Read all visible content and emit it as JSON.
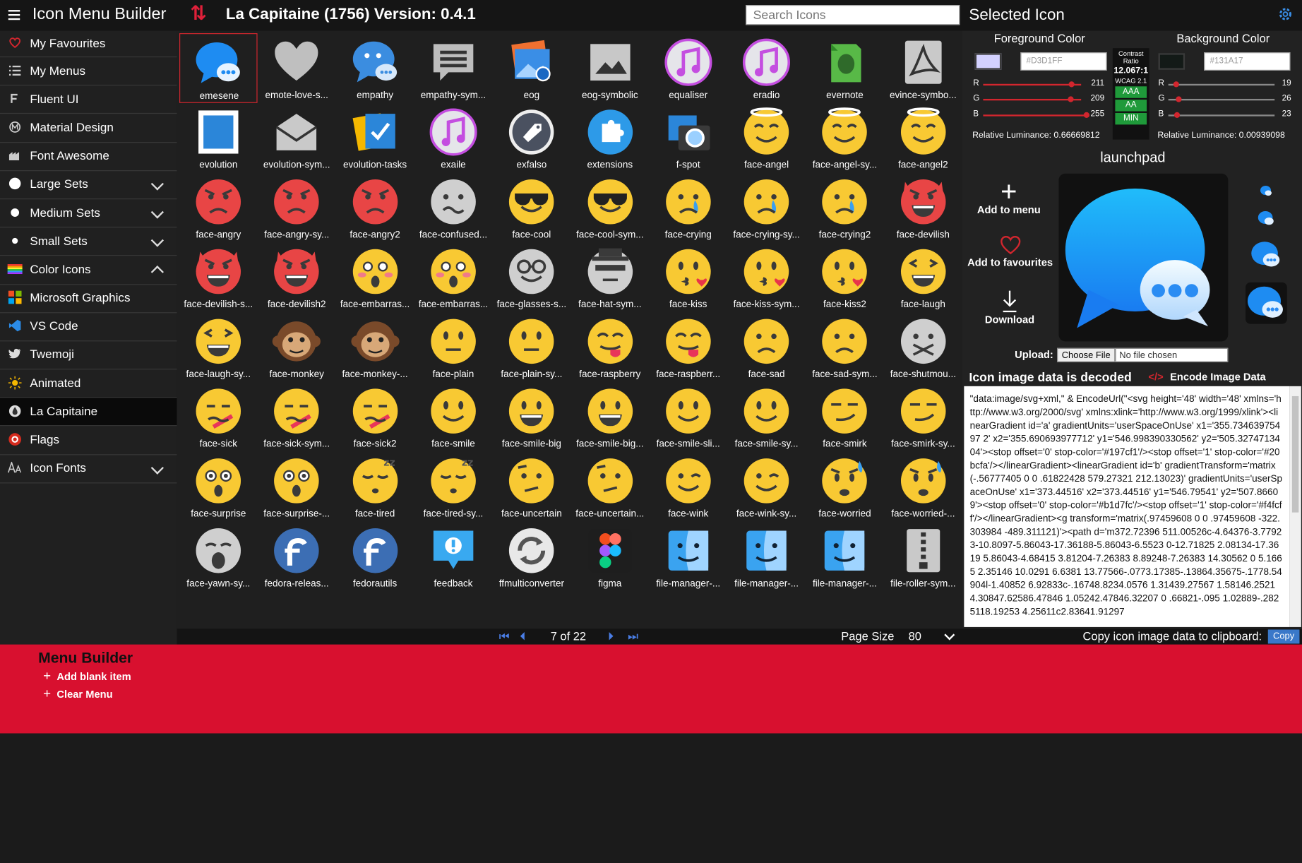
{
  "app": {
    "title": "Icon Menu Builder",
    "page_title": "La Capitaine (1756) Version: 0.4.1",
    "search_placeholder": "Search Icons"
  },
  "sidebar": {
    "items": [
      {
        "label": "My Favourites",
        "icon": "heart-icon",
        "expand": "none",
        "active": false
      },
      {
        "label": "My Menus",
        "icon": "list-icon",
        "expand": "none",
        "active": false
      },
      {
        "label": "Fluent UI",
        "icon": "fluent-icon",
        "expand": "none",
        "active": false
      },
      {
        "label": "Material Design",
        "icon": "material-icon",
        "expand": "none",
        "active": false
      },
      {
        "label": "Font Awesome",
        "icon": "font-awesome-icon",
        "expand": "none",
        "active": false
      },
      {
        "label": "Large Sets",
        "icon": "large-dot-icon",
        "expand": "down",
        "active": false
      },
      {
        "label": "Medium Sets",
        "icon": "medium-dot-icon",
        "expand": "down",
        "active": false
      },
      {
        "label": "Small Sets",
        "icon": "small-dot-icon",
        "expand": "down",
        "active": false
      },
      {
        "label": "Color Icons",
        "icon": "rainbow-icon",
        "expand": "up",
        "active": false
      },
      {
        "label": "Microsoft Graphics",
        "icon": "microsoft-icon",
        "expand": "none",
        "active": false
      },
      {
        "label": "VS Code",
        "icon": "vscode-icon",
        "expand": "none",
        "active": false
      },
      {
        "label": "Twemoji",
        "icon": "twitter-icon",
        "expand": "none",
        "active": false
      },
      {
        "label": "Animated",
        "icon": "sun-icon",
        "expand": "none",
        "active": false
      },
      {
        "label": "La Capitaine",
        "icon": "drop-icon",
        "expand": "none",
        "active": true
      },
      {
        "label": "Flags",
        "icon": "flag-icon",
        "expand": "none",
        "active": false
      },
      {
        "label": "Icon Fonts",
        "icon": "font-icon",
        "expand": "down",
        "active": false
      }
    ]
  },
  "grid": {
    "selected_index": 0,
    "icons": [
      {
        "label": "emesene",
        "icon": "chat-bubbles-icon"
      },
      {
        "label": "emote-love-s...",
        "icon": "heart-icon"
      },
      {
        "label": "empathy",
        "icon": "chat-face-icon"
      },
      {
        "label": "empathy-sym...",
        "icon": "chat-lines-icon"
      },
      {
        "label": "eog",
        "icon": "photo-stack-icon"
      },
      {
        "label": "eog-symbolic",
        "icon": "image-icon"
      },
      {
        "label": "equaliser",
        "icon": "music-note-icon"
      },
      {
        "label": "eradio",
        "icon": "music-note-icon"
      },
      {
        "label": "evernote",
        "icon": "evernote-icon"
      },
      {
        "label": "evince-symbo...",
        "icon": "pdf-icon"
      },
      {
        "label": "evolution",
        "icon": "stamp-icon"
      },
      {
        "label": "evolution-sym...",
        "icon": "envelope-icon"
      },
      {
        "label": "evolution-tasks",
        "icon": "check-card-icon"
      },
      {
        "label": "exaile",
        "icon": "music-note-icon"
      },
      {
        "label": "exfalso",
        "icon": "tag-icon"
      },
      {
        "label": "extensions",
        "icon": "puzzle-icon"
      },
      {
        "label": "f-spot",
        "icon": "camera-icon"
      },
      {
        "label": "face-angel",
        "icon": "face-angel-icon"
      },
      {
        "label": "face-angel-sy...",
        "icon": "face-angel-icon"
      },
      {
        "label": "face-angel2",
        "icon": "face-angel-icon"
      },
      {
        "label": "face-angry",
        "icon": "face-angry-icon"
      },
      {
        "label": "face-angry-sy...",
        "icon": "face-angry-icon"
      },
      {
        "label": "face-angry2",
        "icon": "face-angry-icon"
      },
      {
        "label": "face-confused...",
        "icon": "face-confused-icon"
      },
      {
        "label": "face-cool",
        "icon": "face-cool-icon"
      },
      {
        "label": "face-cool-sym...",
        "icon": "face-cool-icon"
      },
      {
        "label": "face-crying",
        "icon": "face-crying-icon"
      },
      {
        "label": "face-crying-sy...",
        "icon": "face-crying-icon"
      },
      {
        "label": "face-crying2",
        "icon": "face-crying-icon"
      },
      {
        "label": "face-devilish",
        "icon": "face-devil-icon"
      },
      {
        "label": "face-devilish-s...",
        "icon": "face-devil-icon"
      },
      {
        "label": "face-devilish2",
        "icon": "face-devil-icon"
      },
      {
        "label": "face-embarras...",
        "icon": "face-embarrassed-icon"
      },
      {
        "label": "face-embarras...",
        "icon": "face-embarrassed-icon"
      },
      {
        "label": "face-glasses-s...",
        "icon": "face-glasses-icon"
      },
      {
        "label": "face-hat-sym...",
        "icon": "face-hat-icon"
      },
      {
        "label": "face-kiss",
        "icon": "face-kiss-icon"
      },
      {
        "label": "face-kiss-sym...",
        "icon": "face-kiss-icon"
      },
      {
        "label": "face-kiss2",
        "icon": "face-kiss-icon"
      },
      {
        "label": "face-laugh",
        "icon": "face-laugh-icon"
      },
      {
        "label": "face-laugh-sy...",
        "icon": "face-laugh-icon"
      },
      {
        "label": "face-monkey",
        "icon": "face-monkey-icon"
      },
      {
        "label": "face-monkey-...",
        "icon": "face-monkey-icon"
      },
      {
        "label": "face-plain",
        "icon": "face-plain-icon"
      },
      {
        "label": "face-plain-sy...",
        "icon": "face-plain-icon"
      },
      {
        "label": "face-raspberry",
        "icon": "face-raspberry-icon"
      },
      {
        "label": "face-raspberr...",
        "icon": "face-raspberry-icon"
      },
      {
        "label": "face-sad",
        "icon": "face-sad-icon"
      },
      {
        "label": "face-sad-sym...",
        "icon": "face-sad-icon"
      },
      {
        "label": "face-shutmou...",
        "icon": "face-shutmouth-icon"
      },
      {
        "label": "face-sick",
        "icon": "face-sick-icon"
      },
      {
        "label": "face-sick-sym...",
        "icon": "face-sick-icon"
      },
      {
        "label": "face-sick2",
        "icon": "face-sick-icon"
      },
      {
        "label": "face-smile",
        "icon": "face-smile-icon"
      },
      {
        "label": "face-smile-big",
        "icon": "face-smile-big-icon"
      },
      {
        "label": "face-smile-big...",
        "icon": "face-smile-big-icon"
      },
      {
        "label": "face-smile-sli...",
        "icon": "face-smile-icon"
      },
      {
        "label": "face-smile-sy...",
        "icon": "face-smile-icon"
      },
      {
        "label": "face-smirk",
        "icon": "face-smirk-icon"
      },
      {
        "label": "face-smirk-sy...",
        "icon": "face-smirk-icon"
      },
      {
        "label": "face-surprise",
        "icon": "face-surprise-icon"
      },
      {
        "label": "face-surprise-...",
        "icon": "face-surprise-icon"
      },
      {
        "label": "face-tired",
        "icon": "face-tired-icon"
      },
      {
        "label": "face-tired-sy...",
        "icon": "face-tired-icon"
      },
      {
        "label": "face-uncertain",
        "icon": "face-uncertain-icon"
      },
      {
        "label": "face-uncertain...",
        "icon": "face-uncertain-icon"
      },
      {
        "label": "face-wink",
        "icon": "face-wink-icon"
      },
      {
        "label": "face-wink-sy...",
        "icon": "face-wink-icon"
      },
      {
        "label": "face-worried",
        "icon": "face-worried-icon"
      },
      {
        "label": "face-worried-...",
        "icon": "face-worried-icon"
      },
      {
        "label": "face-yawn-sy...",
        "icon": "face-yawn-icon"
      },
      {
        "label": "fedora-releas...",
        "icon": "fedora-icon"
      },
      {
        "label": "fedorautils",
        "icon": "fedora-icon"
      },
      {
        "label": "feedback",
        "icon": "feedback-icon"
      },
      {
        "label": "ffmulticonverter",
        "icon": "convert-icon"
      },
      {
        "label": "figma",
        "icon": "figma-icon"
      },
      {
        "label": "file-manager-...",
        "icon": "finder-icon"
      },
      {
        "label": "file-manager-...",
        "icon": "finder-icon"
      },
      {
        "label": "file-manager-...",
        "icon": "finder-icon"
      },
      {
        "label": "file-roller-sym...",
        "icon": "zip-icon"
      }
    ]
  },
  "pager": {
    "indicator": "7 of 22",
    "page_size_label": "Page Size",
    "page_size_value": "80"
  },
  "selected": {
    "panel_title": "Selected Icon",
    "foreground_label": "Foreground Color",
    "background_label": "Background Color",
    "fg_hex": "#D3D1FF",
    "bg_hex": "#131A17",
    "fg_rgb": {
      "r": "211",
      "g": "209",
      "b": "255"
    },
    "bg_rgb": {
      "r": "19",
      "g": "26",
      "b": "23"
    },
    "rgb_letters": {
      "r": "R",
      "g": "G",
      "b": "B"
    },
    "fg_luminance": "Relative Luminance: 0.66669812",
    "bg_luminance": "Relative Luminance: 0.00939098",
    "contrast_label": "Contrast Ratio",
    "contrast_value": "12.067:1",
    "wcag_label": "WCAG 2.1",
    "wcag_aaa": "AAA",
    "wcag_aa": "AA",
    "wcag_min": "MIN",
    "icon_name": "launchpad",
    "add_to_menu": "Add to menu",
    "add_to_favourites": "Add to favourites",
    "download": "Download",
    "upload_label": "Upload:",
    "choose_file": "Choose File",
    "no_file": "No file chosen",
    "decoded_title": "Icon image data is decoded",
    "encode_label": "Encode Image Data",
    "image_data": "\"data:image/svg+xml,\" & EncodeUrl(\"<svg height='48' width='48' xmlns='http://www.w3.org/2000/svg' xmlns:xlink='http://www.w3.org/1999/xlink'><linearGradient id='a' gradientUnits='userSpaceOnUse' x1='355.73463975497 2' x2='355.690693977712' y1='546.998390330562' y2='505.3274713404'><stop offset='0' stop-color='#197cf1'/><stop offset='1' stop-color='#20bcfa'/></linearGradient><linearGradient id='b' gradientTransform='matrix(-.56777405 0 0 .61822428 579.27321 212.13023)' gradientUnits='userSpaceOnUse' x1='373.44516' x2='373.44516' y1='546.79541' y2='507.86609'><stop offset='0' stop-color='#b1d7fc'/><stop offset='1' stop-color='#f4fcff'/></linearGradient><g transform='matrix(.97459608 0 0 .97459608 -322.303984 -489.311121)'><path d='m372.72396 511.00526c-4.64376-3.77923-10.8097-5.86043-17.36188-5.86043-6.5523 0-12.71825 2.08134-17.3619 5.86043-4.68415 3.81204-7.26383 8.89248-7.26383 14.30562 0 5.1665 2.35146 10.0291 6.6381 13.77566-.0773.17385-.13864.35675-.1778.54904l-1.40852 6.92833c-.16748.8234.0576 1.31439.27567 1.58146.25214.30847.62586.47846 1.05242.47846.32207 0 .66821-.095 1.02889-.2825118.19253 4.25611c2.83641.91297"
  },
  "copy": {
    "label": "Copy icon image data to clipboard:",
    "button": "Copy"
  },
  "builder": {
    "title": "Menu Builder",
    "add_blank": "Add blank item",
    "clear_menu": "Clear Menu"
  },
  "colors": {
    "accent_red": "#d8102f",
    "link_blue": "#3a8ee6",
    "fg_swatch": "#D3D1FF",
    "bg_swatch": "#131A17",
    "wcag_green": "#1f9a3a"
  }
}
